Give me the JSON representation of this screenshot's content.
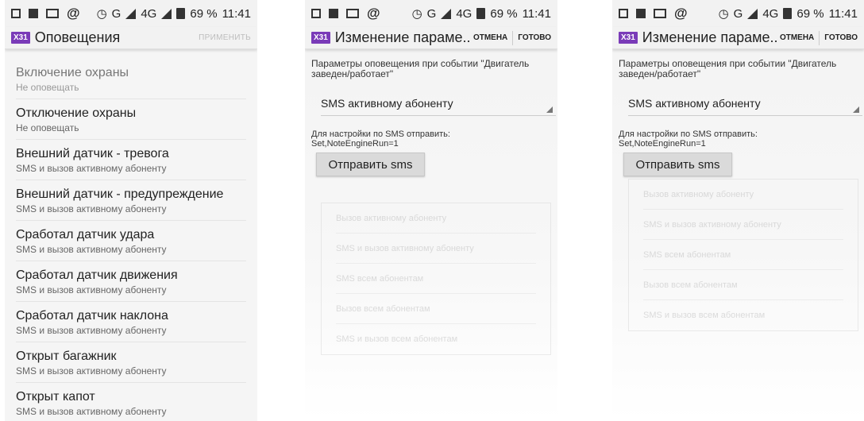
{
  "status": {
    "time": "11:41",
    "battery": "69 %",
    "network": "G",
    "network2": "4G"
  },
  "screen1": {
    "app_badge": "X31",
    "title": "Оповещения",
    "apply_label": "ПРИМЕНИТЬ",
    "items": [
      {
        "title": "Включение охраны",
        "subtitle": "Не оповещать"
      },
      {
        "title": "Отключение охраны",
        "subtitle": "Не оповещать"
      },
      {
        "title": "Внешний датчик - тревога",
        "subtitle": "SMS и вызов активному абоненту"
      },
      {
        "title": "Внешний датчик - предупреждение",
        "subtitle": "SMS и вызов активному абоненту"
      },
      {
        "title": "Сработал датчик удара",
        "subtitle": "SMS и вызов активному абоненту"
      },
      {
        "title": "Сработал датчик движения",
        "subtitle": "SMS и вызов активному абоненту"
      },
      {
        "title": "Сработал датчик наклона",
        "subtitle": "SMS и вызов активному абоненту"
      },
      {
        "title": "Открыт багажник",
        "subtitle": "SMS и вызов активному абоненту"
      },
      {
        "title": "Открыт капот",
        "subtitle": "SMS и вызов активному абоненту"
      }
    ]
  },
  "dialog": {
    "app_badge": "X31",
    "title": "Изменение параме..",
    "cancel_label": "ОТМЕНА",
    "done_label": "ГОТОВО",
    "description": "Параметры оповещения при событии \"Двигатель заведен/работает\"",
    "spinner_value": "SMS активному абоненту",
    "hint_line1": "Для настройки по SMS отправить:",
    "hint_line2": "Set,NoteEngineRun=1",
    "send_label": "Отправить sms",
    "ghost_options": [
      "Вызов активному абоненту",
      "SMS и вызов активному абоненту",
      "SMS всем абонентам",
      "Вызов всем абонентам",
      "SMS и вызов всем абонентам"
    ]
  }
}
